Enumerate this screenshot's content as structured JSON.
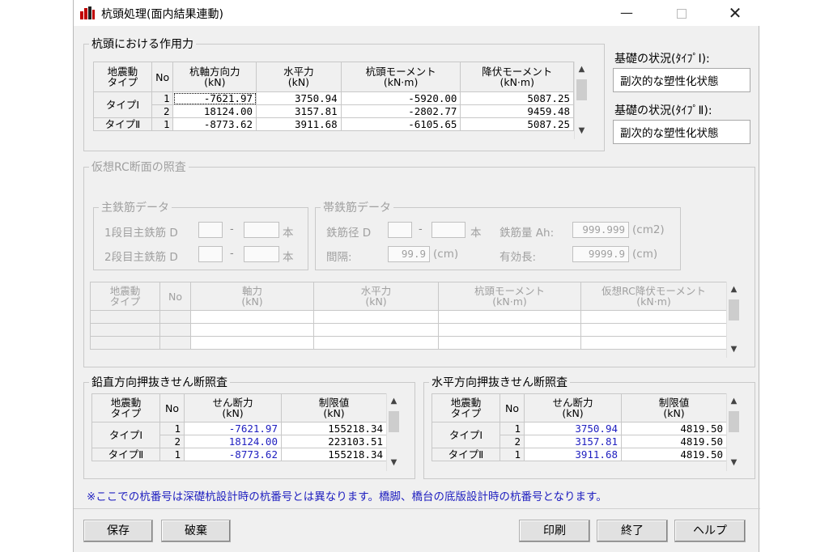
{
  "window": {
    "title": "杭頭処理(面内結果連動)",
    "min_icon": "minimize-icon",
    "max_icon": "maximize-icon",
    "close_icon": "close-icon"
  },
  "forces": {
    "legend": "杭頭における作用力",
    "headers": [
      "地震動タイプ",
      "No",
      "杭軸方向力(kN)",
      "水平力(kN)",
      "杭頭モーメント(kN·m)",
      "降伏モーメント(kN·m)"
    ],
    "header_lines": [
      [
        "地震動",
        "タイプ"
      ],
      [
        "No"
      ],
      [
        "杭軸方向力",
        "(kN)"
      ],
      [
        "水平力",
        "(kN)"
      ],
      [
        "杭頭モーメント",
        "(kN·m)"
      ],
      [
        "降伏モーメント",
        "(kN·m)"
      ]
    ],
    "rows": [
      {
        "type": "タイプⅠ",
        "no": "1",
        "axial": "-7621.97",
        "horizontal": "3750.94",
        "moment": "-5920.00",
        "yield": "5087.25"
      },
      {
        "type": "",
        "no": "2",
        "axial": "18124.00",
        "horizontal": "3157.81",
        "moment": "-2802.77",
        "yield": "9459.48"
      },
      {
        "type": "タイプⅡ",
        "no": "1",
        "axial": "-8773.62",
        "horizontal": "3911.68",
        "moment": "-6105.65",
        "yield": "5087.25"
      }
    ]
  },
  "foundation": {
    "type1_label": "基礎の状況(ﾀｲﾌﾟⅠ):",
    "type1_value": "副次的な塑性化状態",
    "type2_label": "基礎の状況(ﾀｲﾌﾟⅡ):",
    "type2_value": "副次的な塑性化状態"
  },
  "rc": {
    "legend": "仮想RC断面の照査",
    "main_rebar": {
      "legend": "主鉄筋データ",
      "row1_label": "1段目主鉄筋 D",
      "row2_label": "2段目主鉄筋 D",
      "dash": "-",
      "unit": "本"
    },
    "hoop": {
      "legend": "帯鉄筋データ",
      "dia_label": "鉄筋径 D",
      "dash": "-",
      "unit": "本",
      "spacing_label": "間隔:",
      "spacing_value": "99.9",
      "spacing_unit": "(cm)",
      "area_label": "鉄筋量 Ah:",
      "area_value": "999.999",
      "area_unit": "(cm2)",
      "length_label": "有効長:",
      "length_value": "9999.9",
      "length_unit": "(cm)"
    },
    "header_lines": [
      [
        "地震動",
        "タイプ"
      ],
      [
        "No"
      ],
      [
        "軸力",
        "(kN)"
      ],
      [
        "水平力",
        "(kN)"
      ],
      [
        "杭頭モーメント",
        "(kN·m)"
      ],
      [
        "仮想RC降伏モーメント",
        "(kN·m)"
      ]
    ]
  },
  "vertical": {
    "legend": "鉛直方向押抜きせん断照査",
    "header_lines": [
      [
        "地震動",
        "タイプ"
      ],
      [
        "No"
      ],
      [
        "せん断力",
        "(kN)"
      ],
      [
        "制限値",
        "(kN)"
      ]
    ],
    "rows": [
      {
        "type": "タイプⅠ",
        "no": "1",
        "shear": "-7621.97",
        "limit": "155218.34"
      },
      {
        "type": "",
        "no": "2",
        "shear": "18124.00",
        "limit": "223103.51"
      },
      {
        "type": "タイプⅡ",
        "no": "1",
        "shear": "-8773.62",
        "limit": "155218.34"
      }
    ]
  },
  "horizontal": {
    "legend": "水平方向押抜きせん断照査",
    "header_lines": [
      [
        "地震動",
        "タイプ"
      ],
      [
        "No"
      ],
      [
        "せん断力",
        "(kN)"
      ],
      [
        "制限値",
        "(kN)"
      ]
    ],
    "rows": [
      {
        "type": "タイプⅠ",
        "no": "1",
        "shear": "3750.94",
        "limit": "4819.50"
      },
      {
        "type": "",
        "no": "2",
        "shear": "3157.81",
        "limit": "4819.50"
      },
      {
        "type": "タイプⅡ",
        "no": "1",
        "shear": "3911.68",
        "limit": "4819.50"
      }
    ]
  },
  "note": "※ここでの杭番号は深礎杭設計時の杭番号とは異なります。橋脚、橋台の底版設計時の杭番号となります。",
  "buttons": {
    "save": "保存",
    "discard": "破棄",
    "print": "印刷",
    "exit": "終了",
    "help": "ヘルプ"
  },
  "colors": {
    "value_blue": "#2020c0",
    "note_blue": "#2020c0",
    "disabled_gray": "#a0a0a0"
  }
}
